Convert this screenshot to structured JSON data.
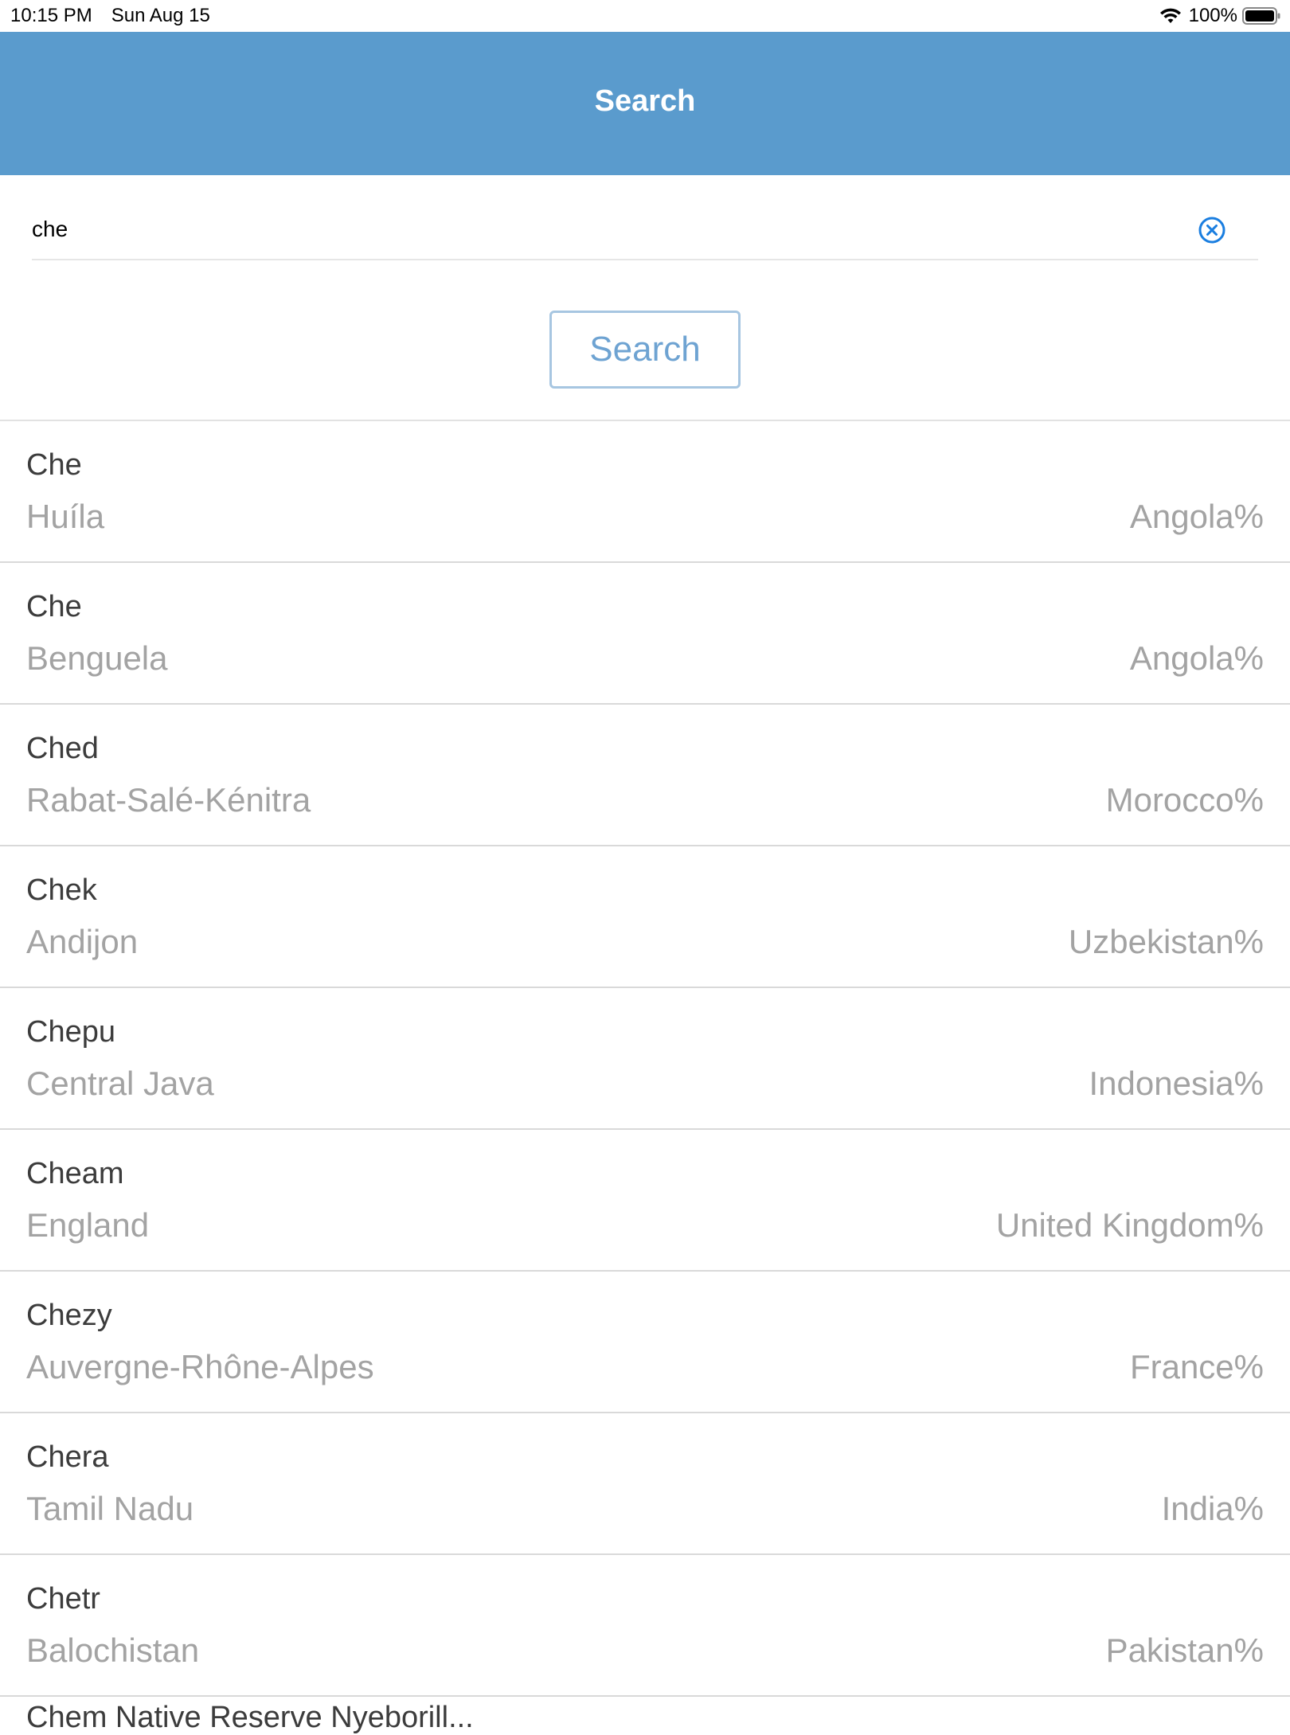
{
  "status_bar": {
    "time": "10:15 PM",
    "date": "Sun Aug 15",
    "battery": "100%"
  },
  "nav": {
    "title": "Search"
  },
  "search": {
    "value": "che",
    "button_label": "Search"
  },
  "results": [
    {
      "name": "Che",
      "region": "Huíla",
      "country": "Angola%"
    },
    {
      "name": "Che",
      "region": "Benguela",
      "country": "Angola%"
    },
    {
      "name": "Ched",
      "region": "Rabat-Salé-Kénitra",
      "country": "Morocco%"
    },
    {
      "name": "Chek",
      "region": "Andijon",
      "country": "Uzbekistan%"
    },
    {
      "name": "Chepu",
      "region": "Central Java",
      "country": "Indonesia%"
    },
    {
      "name": "Cheam",
      "region": "England",
      "country": "United Kingdom%"
    },
    {
      "name": "Chezy",
      "region": "Auvergne-Rhône-Alpes",
      "country": "France%"
    },
    {
      "name": "Chera",
      "region": "Tamil Nadu",
      "country": "India%"
    },
    {
      "name": "Chetr",
      "region": "Balochistan",
      "country": "Pakistan%"
    }
  ],
  "partial_result": {
    "name": "Chem Native Reserve Nyeborill..."
  },
  "colors": {
    "nav_background": "#5a9bcd",
    "accent": "#1a7ee0",
    "secondary_text": "#a3a3a3"
  },
  "icons": {
    "clear": "clear-circle-x-icon",
    "wifi": "wifi-icon",
    "battery": "battery-icon"
  }
}
